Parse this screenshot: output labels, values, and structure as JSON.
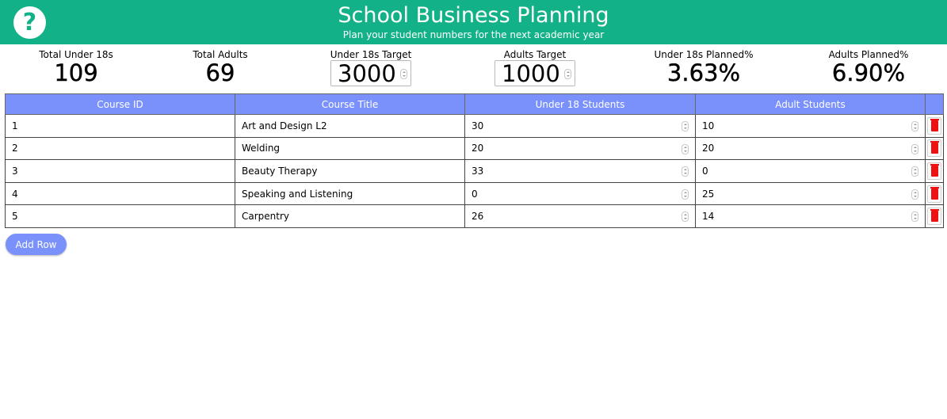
{
  "header": {
    "title": "School Business Planning",
    "subtitle": "Plan your student numbers for the next academic year",
    "help_icon_text": "?"
  },
  "stats": {
    "total_under18_label": "Total Under 18s",
    "total_under18_value": "109",
    "total_adults_label": "Total Adults",
    "total_adults_value": "69",
    "under18_target_label": "Under 18s Target",
    "under18_target_value": "3000",
    "adults_target_label": "Adults Target",
    "adults_target_value": "1000",
    "under18_planned_label": "Under 18s Planned%",
    "under18_planned_value": "3.63%",
    "adults_planned_label": "Adults Planned%",
    "adults_planned_value": "6.90%"
  },
  "table": {
    "columns": [
      "Course ID",
      "Course Title",
      "Under 18 Students",
      "Adult Students",
      ""
    ],
    "rows": [
      {
        "id": "1",
        "title": "Art and Design L2",
        "under18": "30",
        "adults": "10"
      },
      {
        "id": "2",
        "title": "Welding",
        "under18": "20",
        "adults": "20"
      },
      {
        "id": "3",
        "title": "Beauty Therapy",
        "under18": "33",
        "adults": "0"
      },
      {
        "id": "4",
        "title": "Speaking and Listening",
        "under18": "0",
        "adults": "25"
      },
      {
        "id": "5",
        "title": "Carpentry",
        "under18": "26",
        "adults": "14"
      }
    ]
  },
  "add_row_label": "Add Row",
  "colors": {
    "header_bg": "#13b187",
    "table_header_bg": "#7a91fb",
    "delete_icon": "#ee1111"
  }
}
